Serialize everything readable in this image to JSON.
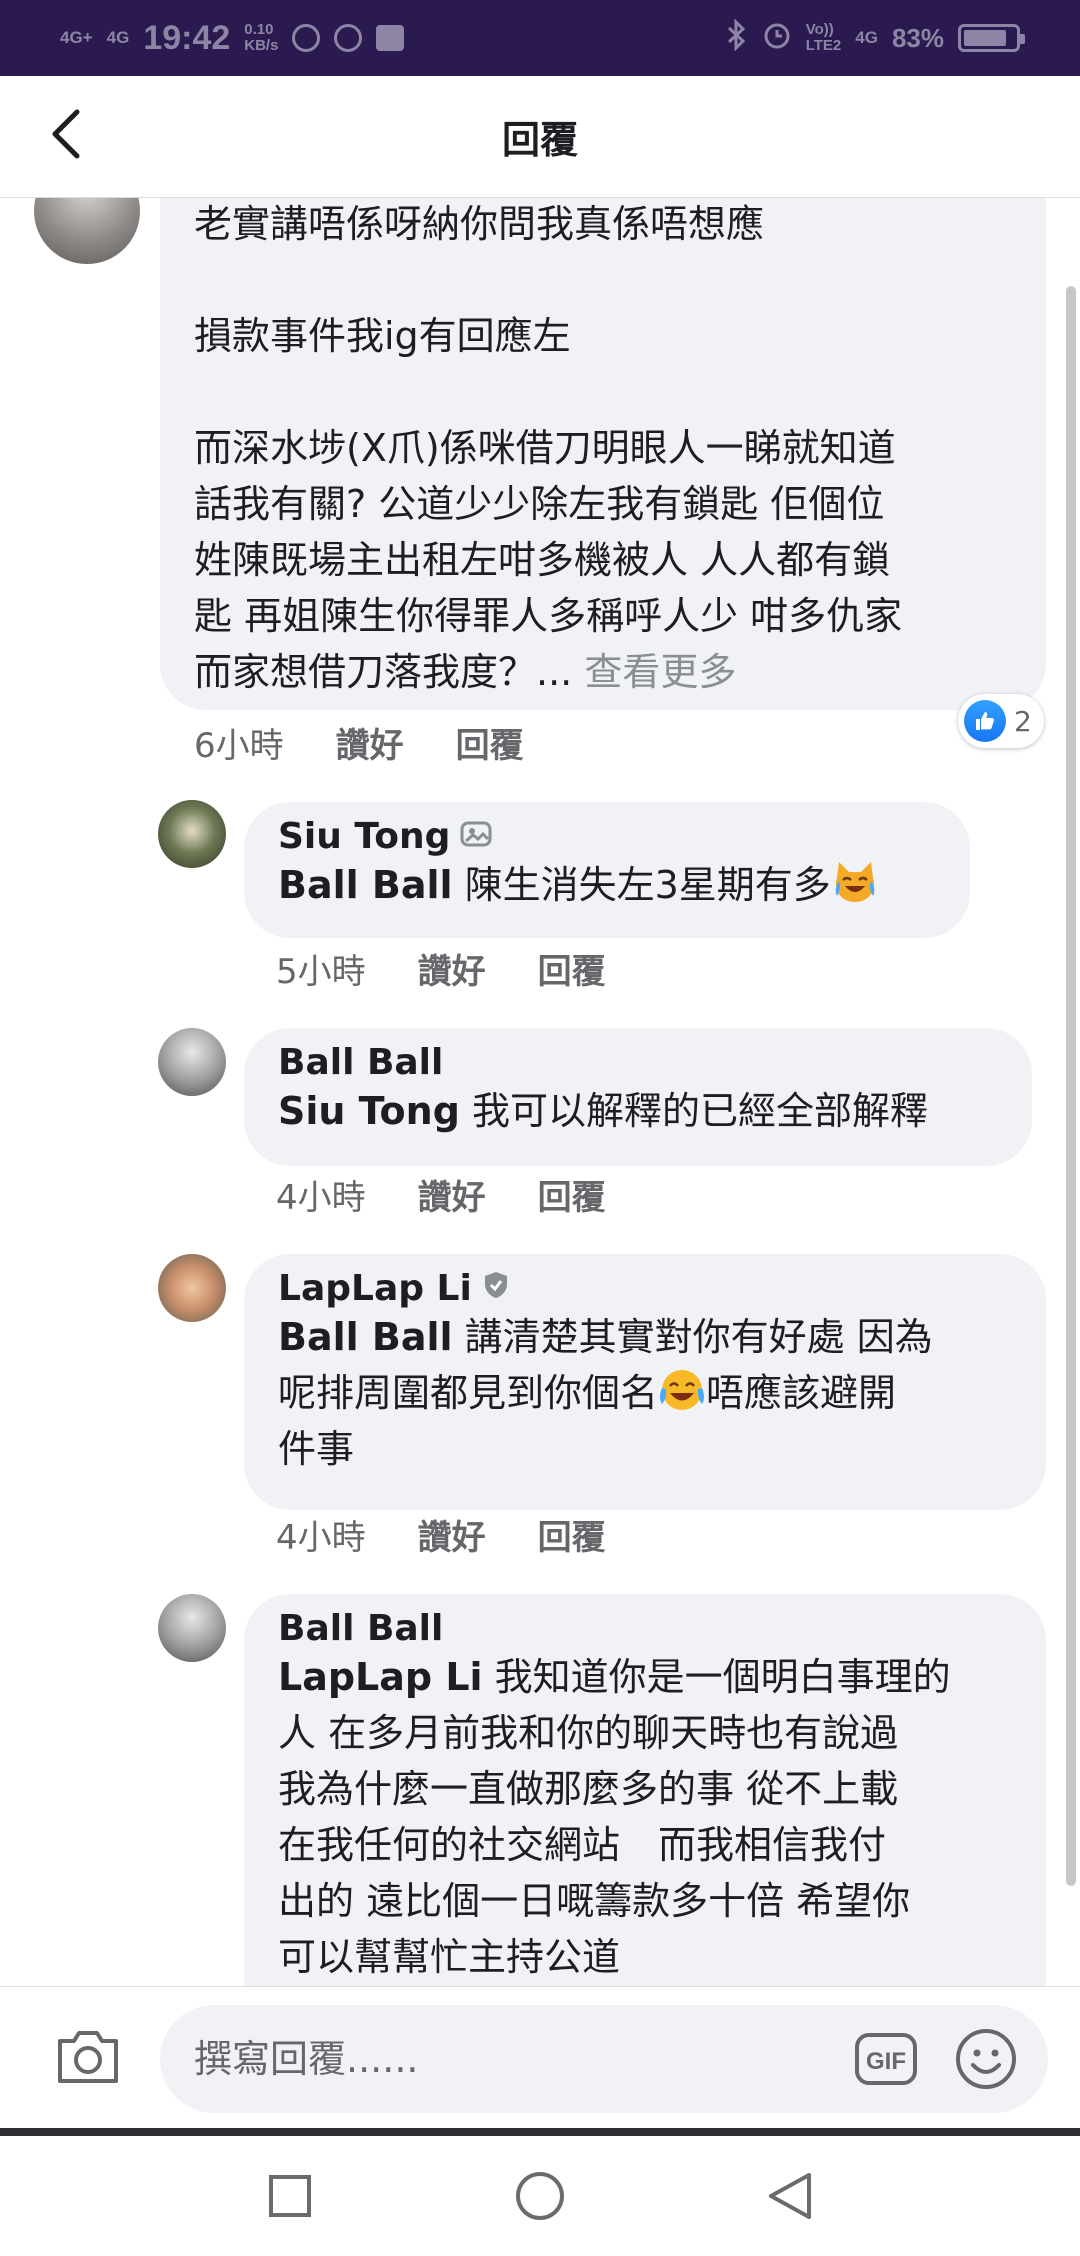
{
  "status_bar": {
    "net1": "4G+",
    "net2": "4G",
    "time": "19:42",
    "speed_value": "0.10",
    "speed_unit": "KB/s",
    "volte": "Vo))",
    "lte": "LTE2",
    "net3": "4G",
    "battery": "83%",
    "battery_level": 0.83
  },
  "header": {
    "title": "回覆"
  },
  "comments": [
    {
      "lines": [
        "老實講唔係呀納你問我真係唔想應",
        "",
        "損款事件我ig有回應左",
        "",
        "而深水埗(X爪)係咪借刀明眼人一睇就知道",
        "話我有關? 公道少少除左我有鎖匙 佢個位",
        "姓陳既場主出租左咁多機被人 人人都有鎖",
        "匙 再姐陳生你得罪人多稱呼人少 咁多仇家",
        "而家想借刀落我度？..."
      ],
      "see_more": "查看更多",
      "time": "6小時",
      "like": "讚好",
      "reply": "回覆",
      "reactions": "2"
    },
    {
      "author": "Siu Tong",
      "mention": "Ball Ball",
      "text": " 陳生消失左3星期有多",
      "time": "5小時",
      "like": "讚好",
      "reply": "回覆"
    },
    {
      "author": "Ball Ball",
      "mention": "Siu Tong",
      "text": " 我可以解釋的已經全部解釋",
      "time": "4小時",
      "like": "讚好",
      "reply": "回覆"
    },
    {
      "author": "LapLap Li",
      "mention": "Ball Ball",
      "line1": " 講清楚其實對你有好處 因為",
      "line2a": "呢排周圍都見到你個名",
      "line2b": "唔應該避開",
      "line3": "件事",
      "time": "4小時",
      "like": "讚好",
      "reply": "回覆"
    },
    {
      "author": "Ball Ball",
      "mention": "LapLap Li",
      "line1": " 我知道你是一個明白事理的",
      "lines": [
        "人 在多月前我和你的聊天時也有說過",
        "我為什麼一直做那麼多的事 從不上載",
        "在我任何的社交網站　而我相信我付",
        "出的 遠比個一日嘅籌款多十倍 希望你",
        "可以幫幫忙主持公道"
      ]
    }
  ],
  "composer": {
    "placeholder": "撰寫回覆......",
    "gif_label": "GIF"
  },
  "colors": {
    "status_bar_bg": "#2a1a4f",
    "bubble_bg": "#f0f2f5",
    "like_blue": "#1877f2",
    "meta_gray": "#65676b"
  }
}
